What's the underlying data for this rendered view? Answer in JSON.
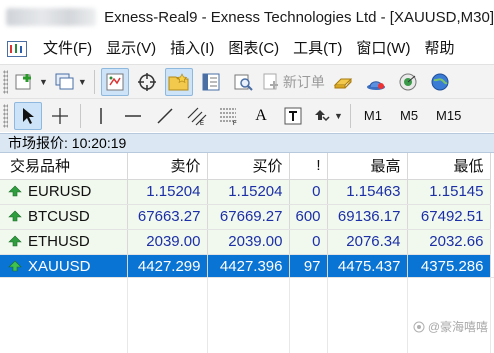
{
  "window": {
    "title": "Exness-Real9 - Exness Technologies Ltd - [XAUUSD,M30]"
  },
  "menu": {
    "items": [
      "文件(F)",
      "显示(V)",
      "插入(I)",
      "图表(C)",
      "工具(T)",
      "窗口(W)",
      "帮助"
    ]
  },
  "toolbar1": {
    "new_order_label": "新订单"
  },
  "toolbar2": {
    "timeframes": [
      "M1",
      "M5",
      "M15"
    ]
  },
  "market_watch": {
    "header": "市场报价: 10:20:19",
    "columns": [
      "交易品种",
      "卖价",
      "买价",
      "!",
      "最高",
      "最低"
    ],
    "rows": [
      {
        "symbol": "EURUSD",
        "bid": "1.15204",
        "ask": "1.15204",
        "spread": "0",
        "high": "1.15463",
        "low": "1.15145",
        "selected": false
      },
      {
        "symbol": "BTCUSD",
        "bid": "67663.27",
        "ask": "67669.27",
        "spread": "600",
        "high": "69136.17",
        "low": "67492.51",
        "selected": false
      },
      {
        "symbol": "ETHUSD",
        "bid": "2039.00",
        "ask": "2039.00",
        "spread": "0",
        "high": "2076.34",
        "low": "2032.66",
        "selected": false
      },
      {
        "symbol": "XAUUSD",
        "bid": "4427.299",
        "ask": "4427.396",
        "spread": "97",
        "high": "4475.437",
        "low": "4375.286",
        "selected": true
      }
    ]
  },
  "watermark": {
    "text": "@豪海嘻嘻"
  },
  "colors": {
    "selected_row": "#0a74d4",
    "row_bg": "#f1f9ee",
    "price_text": "#1c2fa6",
    "up_arrow": "#2e9e3e",
    "header_bg": "#dbe7f3"
  }
}
